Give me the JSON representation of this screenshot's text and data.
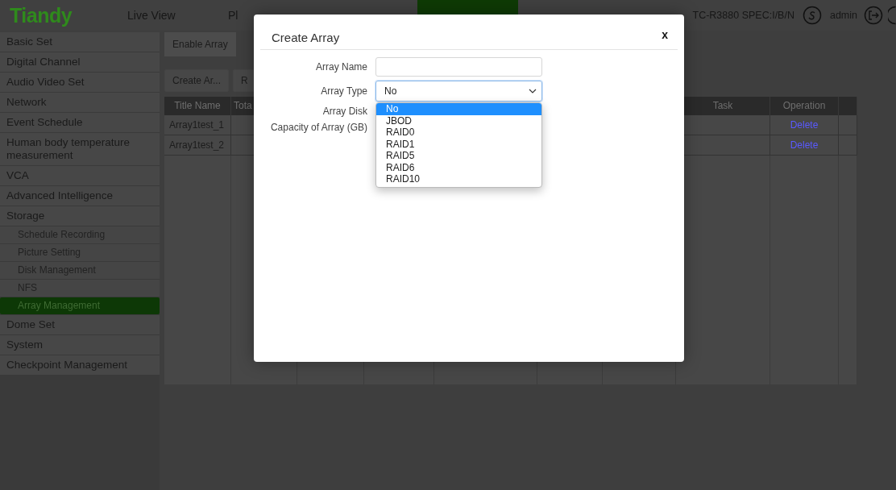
{
  "header": {
    "logo": "Tiandy",
    "nav": [
      {
        "label": "Live View",
        "selected": false
      },
      {
        "label": "Pl",
        "selected": false
      },
      {
        "selected": true
      }
    ],
    "device": "TC-R3880 SPEC:I/B/N",
    "user": "admin"
  },
  "sidebar": {
    "items": [
      {
        "label": "Basic Set",
        "selected": false
      },
      {
        "label": "Digital Channel",
        "selected": false
      },
      {
        "label": "Audio Video Set",
        "selected": false
      },
      {
        "label": "Network",
        "selected": false
      },
      {
        "label": "Event Schedule",
        "selected": false
      },
      {
        "label": "Human body temperature measurement",
        "selected": false
      },
      {
        "label": "VCA",
        "selected": false
      },
      {
        "label": "Advanced Intelligence",
        "selected": false
      },
      {
        "label": "Storage",
        "selected": false,
        "children": [
          {
            "label": "Schedule Recording",
            "selected": false
          },
          {
            "label": "Picture Setting",
            "selected": false
          },
          {
            "label": "Disk Management",
            "selected": false
          },
          {
            "label": "NFS",
            "selected": false
          },
          {
            "label": "Array Management",
            "selected": true
          }
        ]
      },
      {
        "label": "Dome Set",
        "selected": false
      },
      {
        "label": "System",
        "selected": false
      },
      {
        "label": "Checkpoint Management",
        "selected": false
      }
    ]
  },
  "tabs": [
    {
      "label": "Enable Array",
      "selected": true
    }
  ],
  "buttons": [
    "Create Ar...",
    "R"
  ],
  "table": {
    "columns": [
      "Title Name",
      "Tota",
      "Task",
      "Operation"
    ],
    "rows": [
      {
        "title_name": "Array1test_1",
        "operation": "Delete"
      },
      {
        "title_name": "Array1test_2",
        "operation": "Delete"
      }
    ]
  },
  "dialog": {
    "title": "Create Array",
    "close": "x",
    "fields": [
      {
        "label": "Array Name",
        "kind": "input"
      },
      {
        "label": "Array Type",
        "kind": "select",
        "value": "No",
        "expanded": true,
        "options": [
          {
            "label": "No",
            "selected": true
          },
          {
            "label": "JBOD",
            "selected": false
          },
          {
            "label": "RAID0",
            "selected": false
          },
          {
            "label": "RAID1",
            "selected": false
          },
          {
            "label": "RAID5",
            "selected": false
          },
          {
            "label": "RAID6",
            "selected": false
          },
          {
            "label": "RAID10",
            "selected": false
          }
        ]
      },
      {
        "label": "Array Disk",
        "kind": "hidden"
      },
      {
        "label": "Capacity of Array (GB)",
        "kind": "hidden"
      }
    ]
  }
}
